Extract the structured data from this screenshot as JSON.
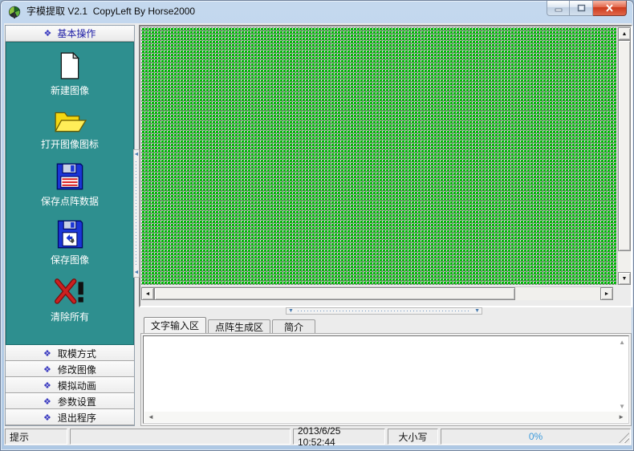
{
  "window": {
    "title": "字模提取 V2.1  CopyLeft By Horse2000"
  },
  "sidebar": {
    "header": {
      "label": "基本操作"
    },
    "tools": [
      {
        "label": "新建图像",
        "icon": "new-image-icon"
      },
      {
        "label": "打开图像图标",
        "icon": "open-image-icon"
      },
      {
        "label": "保存点阵数据",
        "icon": "save-matrix-icon"
      },
      {
        "label": "保存图像",
        "icon": "save-image-icon"
      },
      {
        "label": "清除所有",
        "icon": "clear-all-icon"
      }
    ],
    "nav_items": [
      {
        "label": "取模方式"
      },
      {
        "label": "修改图像"
      },
      {
        "label": "模拟动画"
      },
      {
        "label": "参数设置"
      },
      {
        "label": "退出程序"
      }
    ]
  },
  "tabs": [
    {
      "label": "文字输入区",
      "active": true
    },
    {
      "label": "点阵生成区",
      "active": false
    },
    {
      "label": "简介",
      "active": false
    }
  ],
  "editor": {
    "value": "",
    "placeholder": ""
  },
  "statusbar": {
    "hint_label": "提示",
    "message": "",
    "datetime": "2013/6/25 10:52:44",
    "case_label": "大小写",
    "progress": "0%"
  },
  "icons": {
    "diamond": "❖",
    "arrow_up": "▲",
    "arrow_down": "▼",
    "arrow_left": "◄",
    "arrow_right": "►"
  },
  "colors": {
    "sidebar_teal": "#2E8F8F",
    "grid_green": "#00B606",
    "progress_blue": "#3D9BDC",
    "close_red": "#CC3A1C",
    "header_text_blue": "#1D1DA5"
  }
}
